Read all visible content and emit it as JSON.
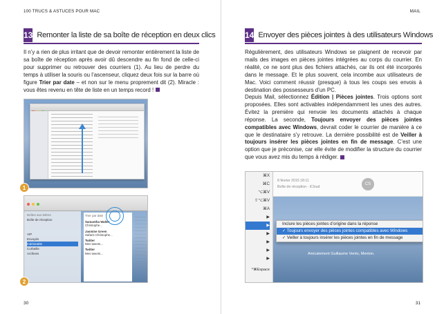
{
  "left_page": {
    "running_head": "100 TRUCS & ASTUCES POUR MAC",
    "folio": "30",
    "section": {
      "number": "13",
      "title": "Remonter la liste de sa boîte de réception en deux clics"
    },
    "body_before_bold": "Il n’y a rien de plus irritant que de devoir remonter entièrement la liste de sa boîte de réception après avoir dû descendre au fin fond de celle-ci pour supprimer ou retrouver des courriers (1). Au lieu de perdre du temps à utiliser la souris ou l’ascenseur, cliquez deux fois sur la barre où figure ",
    "body_bold": "Trier par date",
    "body_after_bold": " – et non sur le menu proprement dit (2). Miracle : vous êtes revenu en tête de liste en un temps record !",
    "figure1": {
      "badge": "1"
    },
    "figure2": {
      "badge": "2",
      "sidebar_items": [
        "Boîtes aux lettres",
        "Boîte de réception",
        "VIP",
        "Envoyés",
        "Indésirable",
        "Corbeille",
        "Archives"
      ],
      "messages": [
        {
          "from": "Samantha Walter",
          "snippet": "Christophe..."
        },
        {
          "from": "Jasmine Green",
          "snippet": "Safaris Christophe..."
        },
        {
          "from": "Twitter",
          "snippet": "Mes tweets..."
        },
        {
          "from": "Twitter",
          "snippet": "Mes tweets..."
        }
      ],
      "sort_label": "Trier par date"
    }
  },
  "right_page": {
    "running_head": "MAIL",
    "folio": "31",
    "section": {
      "number": "14",
      "title": "Envoyer des pièces jointes à des utilisateurs Windows"
    },
    "body_1": "Régulièrement, des utilisateurs Windows se plaignent de recevoir par mails des images en pièces jointes intégrées au corps du courrier. En réalité, ce ne sont plus des fichiers attachés, car ils ont été incorporés dans le message. Et le plus souvent, cela incombe aux utilisateurs de Mac. Voici comment réussir (presque) à tous les coups ses envois à destination des possesseurs d’un PC.",
    "body_2a": "Depuis Mail, sélectionnez ",
    "body_2b": "Édition | Pièces jointes",
    "body_2c": ". Trois options sont proposées. Elles sont activables indépendamment les unes des autres. Évitez la première qui renvoie les documents attachés à chaque réponse. La seconde, ",
    "body_2d": "Toujours envoyer des pièces jointes compatibles avec Windows",
    "body_2e": ", devrait coder le courrier de manière à ce que le destinataire s’y retrouve. La dernière possibilité est de ",
    "body_2f": "Veiller à toujours insérer les pièces jointes en fin de message",
    "body_2g": ". C’est une option que je préconise, car elle évite de modifier la structure du courrier que vous avez mis du temps à rédiger.",
    "figure": {
      "header_date": "8 février 2015 18:11",
      "header_mailbox": "Boîte de réception - iCloud",
      "avatar_initials": "CS",
      "shortcut_keys": [
        "⌘X",
        "⌘C",
        "⌥⌘V",
        "⇧⌥⌘V",
        "⌘A"
      ],
      "menu_items": [
        "Inclure les pièces jointes d’origine dans la réponse",
        "✓ Toujours envoyer des pièces jointes compatibles avec Windows",
        "✓ Veiller à toujours insérer les pièces jointes en fin de message"
      ],
      "signature": "Amicalement Guillaume Vento, Menton.",
      "bottom_key": "^⌘Espace"
    }
  },
  "colors": {
    "accent": "#5d2f86",
    "badge": "#e0a032",
    "selection": "#3479d0"
  }
}
